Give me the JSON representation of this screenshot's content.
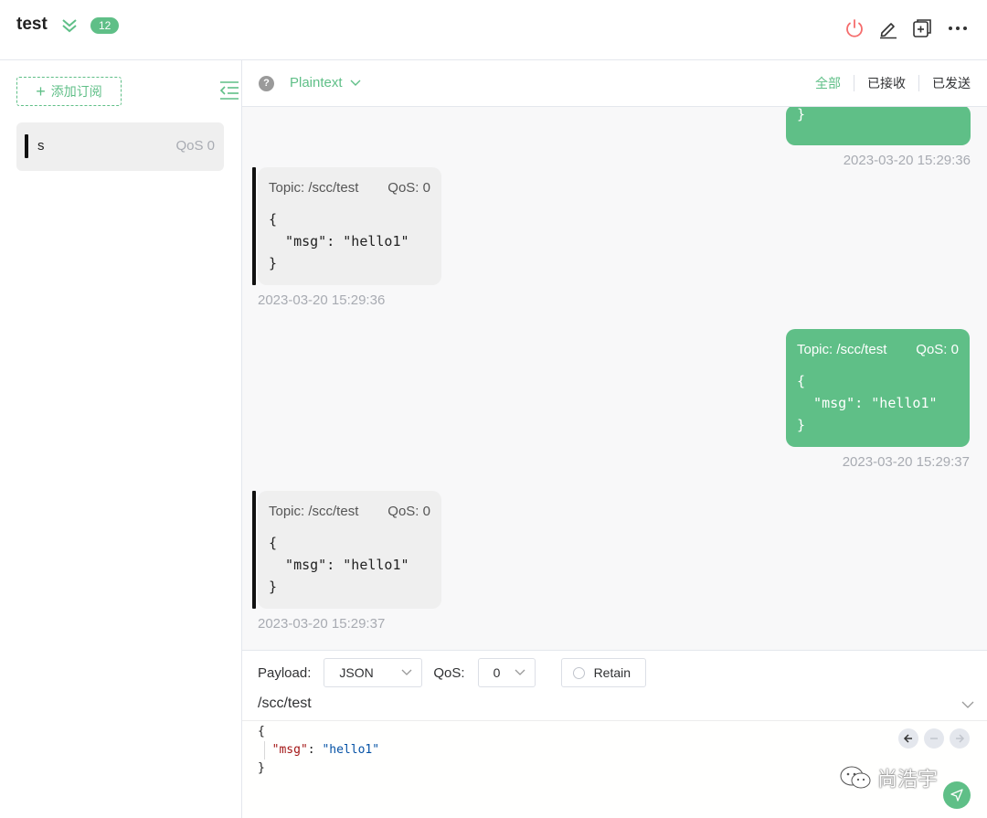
{
  "header": {
    "connection_name": "test",
    "message_count": "12",
    "accent": "#5fbf87",
    "icons": [
      "expand-chevrons-icon",
      "power-icon",
      "edit-icon",
      "new-window-icon",
      "more-icon"
    ]
  },
  "sidebar": {
    "add_subscription_label": "添加订阅",
    "subscriptions": [
      {
        "topic": "s",
        "qos": "QoS 0"
      }
    ]
  },
  "filter": {
    "format": "Plaintext",
    "tabs": [
      "全部",
      "已接收",
      "已发送"
    ],
    "active_tab": "全部"
  },
  "messages": [
    {
      "direction": "sent",
      "partial": true,
      "payload": "}",
      "time": "2023-03-20 15:29:36"
    },
    {
      "direction": "received",
      "topic": "Topic: /scc/test",
      "qos": "QoS: 0",
      "payload": "{\n  \"msg\": \"hello1\"\n}",
      "time": "2023-03-20 15:29:36"
    },
    {
      "direction": "sent",
      "topic": "Topic: /scc/test",
      "qos": "QoS: 0",
      "payload": "{\n  \"msg\": \"hello1\"\n}",
      "time": "2023-03-20 15:29:37"
    },
    {
      "direction": "received",
      "topic": "Topic: /scc/test",
      "qos": "QoS: 0",
      "payload": "{\n  \"msg\": \"hello1\"\n}",
      "time": "2023-03-20 15:29:37"
    }
  ],
  "publish": {
    "payload_label": "Payload:",
    "payload_format": "JSON",
    "qos_label": "QoS:",
    "qos_value": "0",
    "retain_label": "Retain",
    "topic": "/scc/test",
    "editor": {
      "open": "{",
      "key": "\"msg\"",
      "sep": ": ",
      "value": "\"hello1\"",
      "close": "}"
    }
  },
  "watermark": "尚浩宇"
}
